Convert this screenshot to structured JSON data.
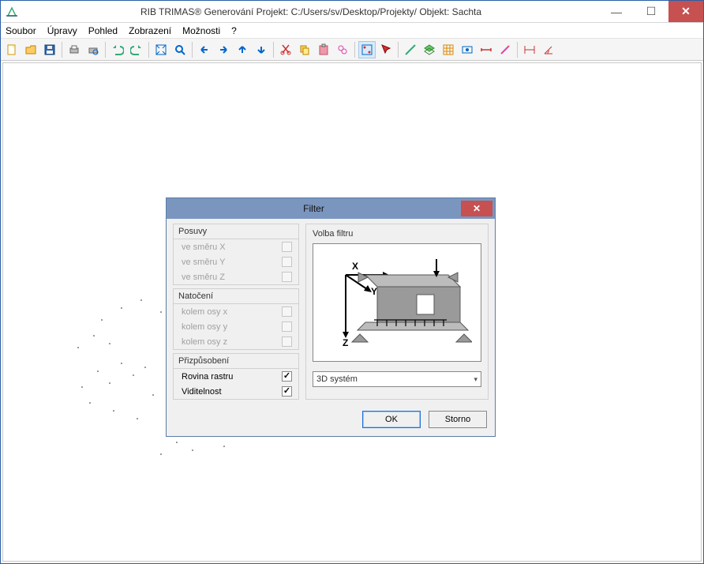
{
  "window": {
    "title": "RIB TRIMAS®  Generování   Projekt: C:/Users/sv/Desktop/Projekty/   Objekt: Sachta"
  },
  "menu": {
    "items": [
      "Soubor",
      "Úpravy",
      "Pohled",
      "Zobrazení",
      "Možnosti",
      "?"
    ]
  },
  "dialog": {
    "title": "Filter",
    "groups": {
      "posuvy": {
        "title": "Posuvy",
        "x": "ve směru X",
        "y": "ve směru Y",
        "z": "ve směru Z"
      },
      "natoceni": {
        "title": "Natočení",
        "x": "kolem osy x",
        "y": "kolem osy y",
        "z": "kolem osy z"
      },
      "priz": {
        "title": "Přizpůsobení",
        "rovina": "Rovina rastru",
        "vidit": "Viditelnost"
      }
    },
    "right": {
      "title": "Volba filtru",
      "axis_x": "X",
      "axis_y": "Y",
      "axis_z": "Z",
      "select_value": "3D systém"
    },
    "buttons": {
      "ok": "OK",
      "storno": "Storno"
    }
  }
}
